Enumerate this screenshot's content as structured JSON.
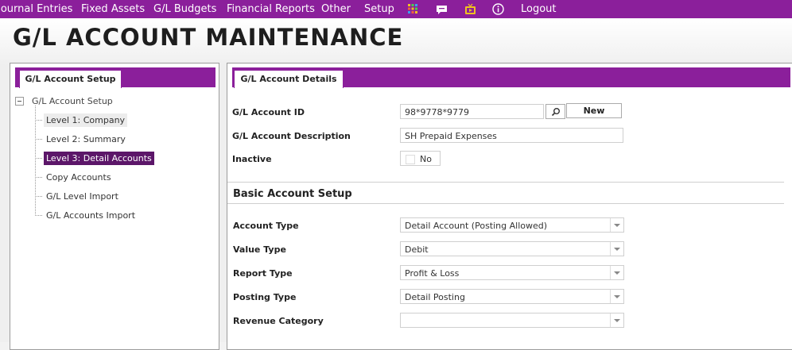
{
  "nav": {
    "items": [
      "Journal Entries",
      "Fixed Assets",
      "G/L Budgets",
      "Financial Reports",
      "Other",
      "Setup"
    ],
    "logout": "Logout",
    "icons": [
      "apps-grid-icon",
      "chat-icon",
      "tv-icon",
      "info-icon"
    ]
  },
  "page": {
    "title": "G/L ACCOUNT MAINTENANCE"
  },
  "sidebar": {
    "tab": "G/L Account Setup",
    "root": "G/L Account Setup",
    "items": [
      {
        "label": "Level 1: Company",
        "state": "hover"
      },
      {
        "label": "Level 2: Summary",
        "state": "normal"
      },
      {
        "label": "Level 3: Detail Accounts",
        "state": "selected"
      },
      {
        "label": "Copy Accounts",
        "state": "normal"
      },
      {
        "label": "G/L Level Import",
        "state": "normal"
      },
      {
        "label": "G/L Accounts Import",
        "state": "normal"
      }
    ]
  },
  "details": {
    "tab": "G/L Account Details",
    "account_id_label": "G/L Account ID",
    "account_id_value": "98*9778*9779",
    "new_button": "New",
    "description_label": "G/L Account Description",
    "description_value": "SH Prepaid Expenses",
    "inactive_label": "Inactive",
    "inactive_value": "No"
  },
  "basic": {
    "title": "Basic Account Setup",
    "account_type_label": "Account Type",
    "account_type_value": "Detail Account (Posting Allowed)",
    "value_type_label": "Value Type",
    "value_type_value": "Debit",
    "report_type_label": "Report Type",
    "report_type_value": "Profit & Loss",
    "posting_type_label": "Posting Type",
    "posting_type_value": "Detail Posting",
    "revenue_category_label": "Revenue Category",
    "revenue_category_value": ""
  },
  "colors": {
    "brand": "#8b1f9b",
    "selected": "#5c1669"
  }
}
